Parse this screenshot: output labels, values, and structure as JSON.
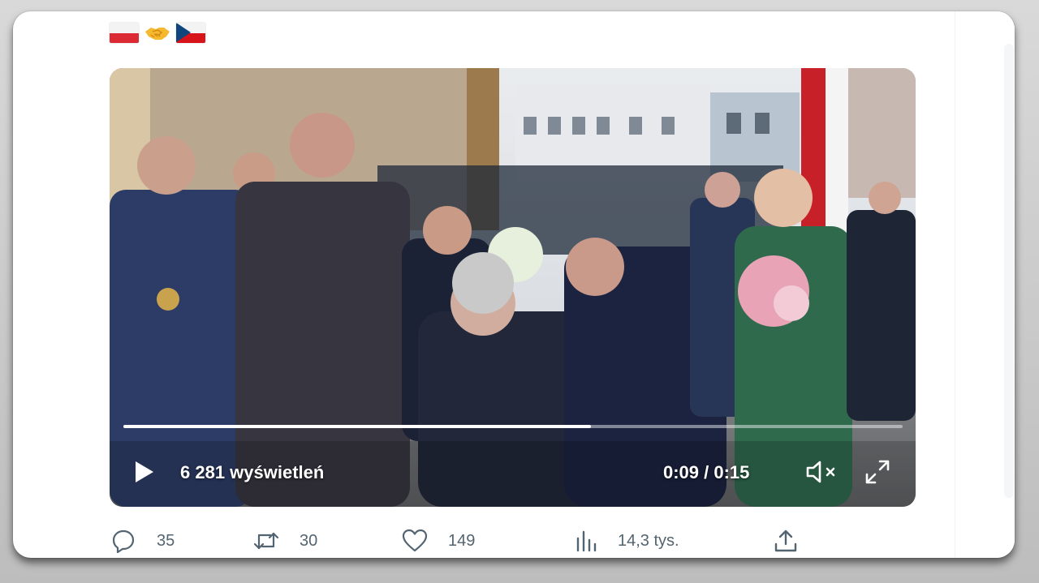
{
  "tweet": {
    "emoji": [
      "flag-poland",
      "handshake",
      "flag-czechia"
    ],
    "video": {
      "views_label": "6 281 wyświetleń",
      "time_label": "0:09 / 0:15",
      "progress_fraction": 0.6,
      "muted": true
    },
    "actions": {
      "reply_count": "35",
      "retweet_count": "30",
      "like_count": "149",
      "views_count": "14,3 tys."
    }
  },
  "colors": {
    "action_gray": "#536471",
    "pl_red": "#dc2a35",
    "cz_blue": "#11457e"
  }
}
